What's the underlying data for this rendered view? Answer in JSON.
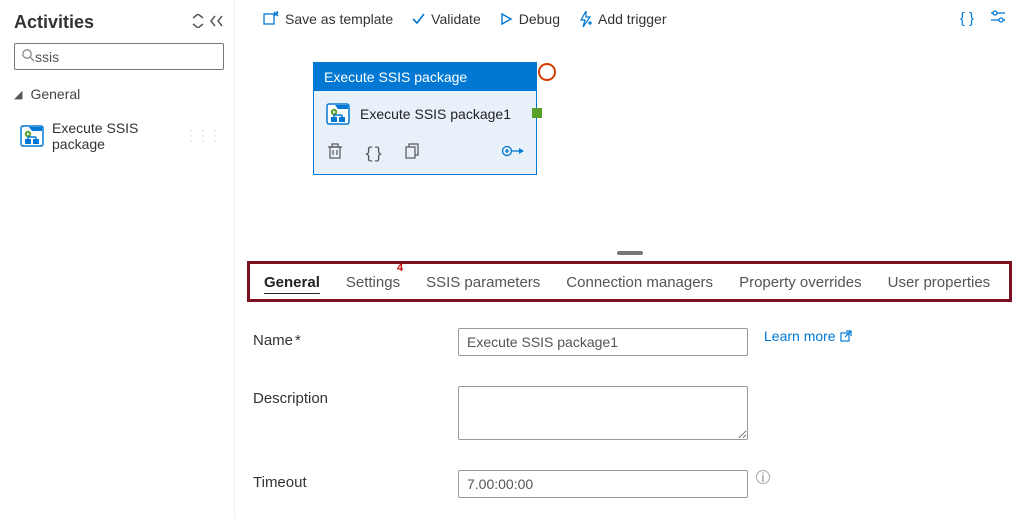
{
  "sidebar": {
    "title": "Activities",
    "search_value": "ssis",
    "tree": {
      "general": "General"
    },
    "items": [
      {
        "label": "Execute SSIS package"
      }
    ]
  },
  "toolbar": {
    "save_template": "Save as template",
    "validate": "Validate",
    "debug": "Debug",
    "add_trigger": "Add trigger"
  },
  "node": {
    "header": "Execute SSIS package",
    "label": "Execute SSIS package1"
  },
  "tabs": {
    "items": [
      "General",
      "Settings",
      "SSIS parameters",
      "Connection managers",
      "Property overrides",
      "User properties"
    ],
    "active": 0,
    "badge": "4"
  },
  "form": {
    "name_label": "Name",
    "name_value": "Execute SSIS package1",
    "desc_label": "Description",
    "desc_value": "",
    "timeout_label": "Timeout",
    "timeout_value": "7.00:00:00",
    "learn_more": "Learn more"
  }
}
